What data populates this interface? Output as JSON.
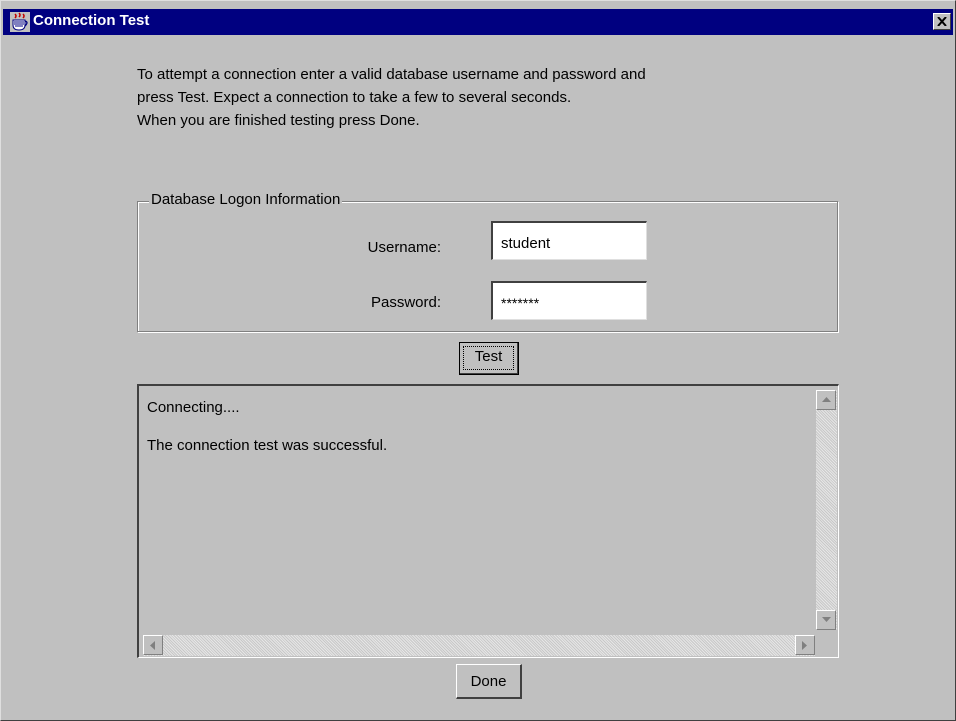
{
  "window": {
    "title": "Connection Test"
  },
  "intro": {
    "lines": [
      "To attempt a connection enter a valid database username and password and",
      "press Test.  Expect a connection to take a few to several seconds.",
      "When you are finished testing press Done."
    ]
  },
  "logon": {
    "group_title": "Database Logon Information",
    "username_label": "Username:",
    "username_value": "student",
    "password_label": "Password:",
    "password_value": "*******"
  },
  "buttons": {
    "test": "Test",
    "done": "Done"
  },
  "output": {
    "lines": [
      "Connecting....",
      "The connection test was successful."
    ]
  },
  "icons": {
    "app": "java-cup-icon",
    "close": "close-icon",
    "scroll_up": "arrow-up-icon",
    "scroll_down": "arrow-down-icon",
    "scroll_left": "arrow-left-icon",
    "scroll_right": "arrow-right-icon"
  },
  "colors": {
    "titlebar": "#000080",
    "face": "#c0c0c0"
  }
}
